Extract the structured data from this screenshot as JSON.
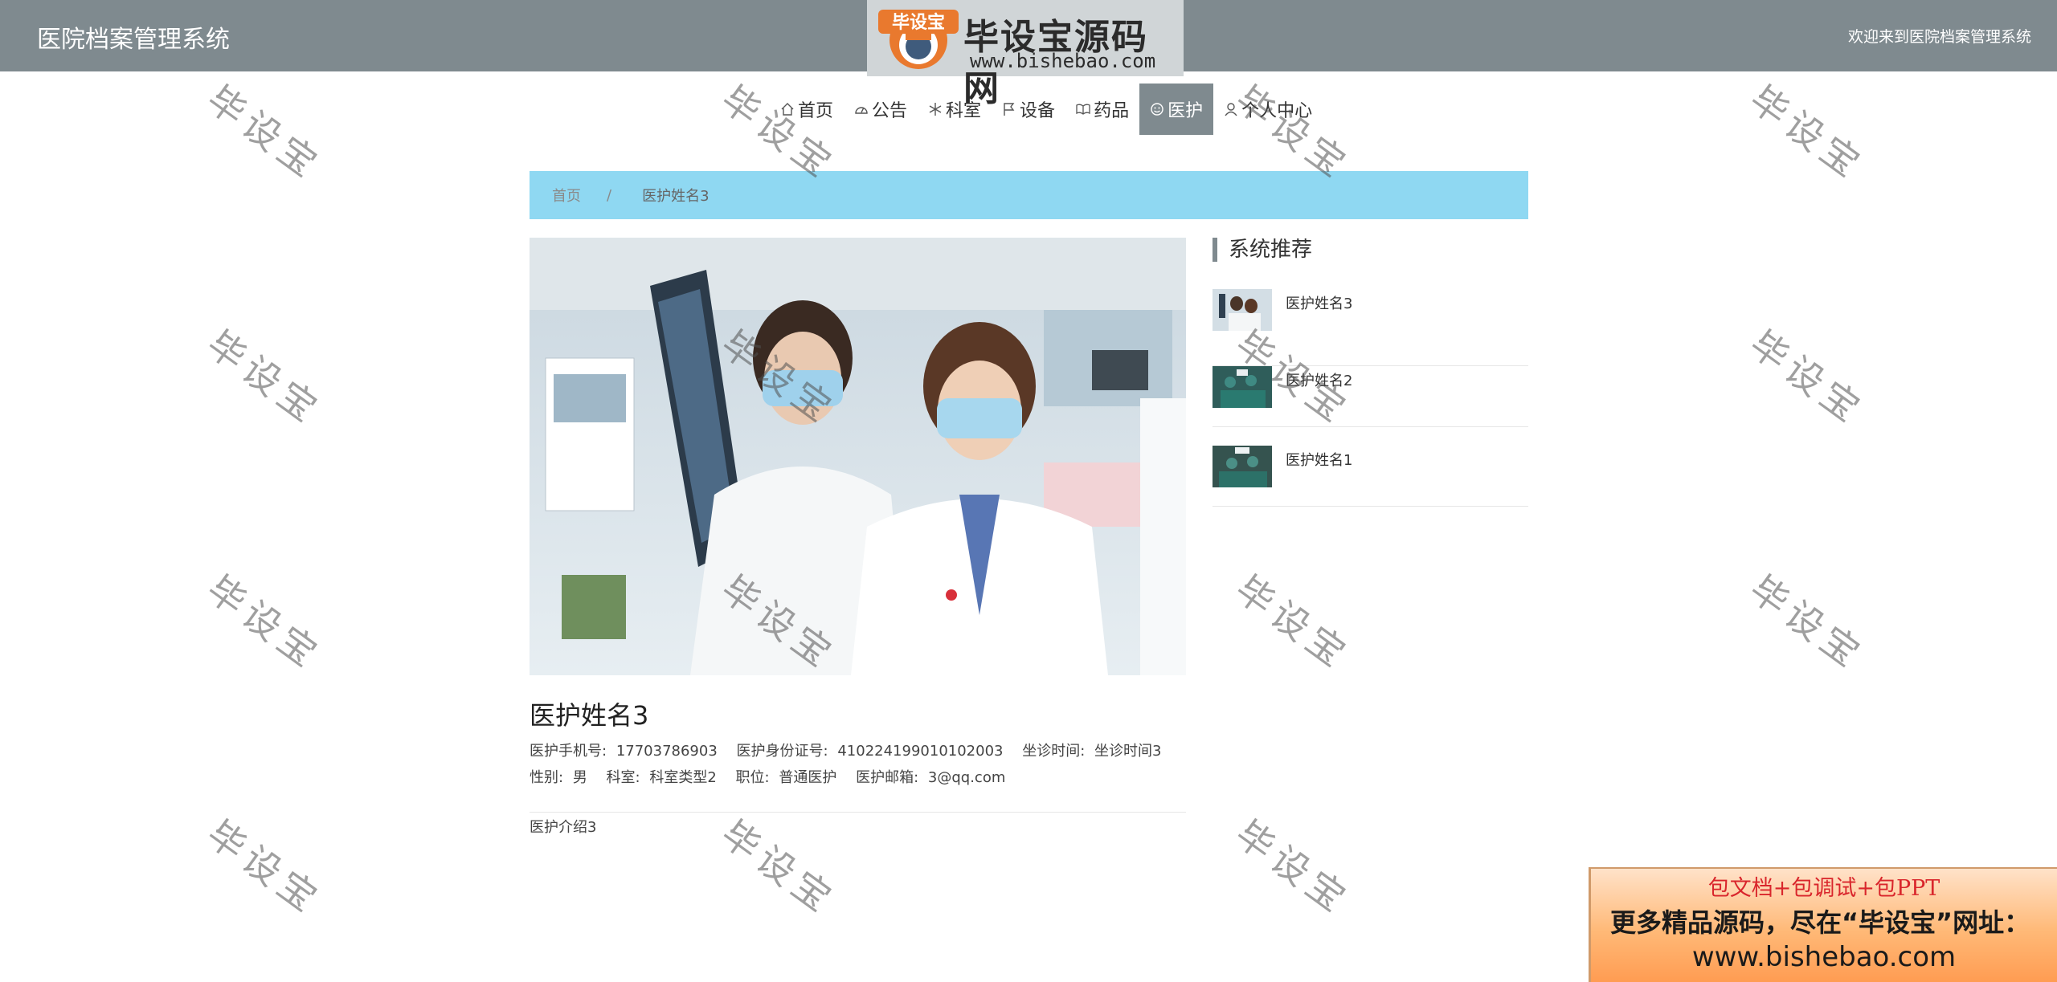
{
  "header": {
    "title": "医院档案管理系统",
    "welcome": "欢迎来到医院档案管理系统"
  },
  "logo": {
    "badge": "毕设宝",
    "name": "毕设宝源码网",
    "url": "www.bishebao.com"
  },
  "nav": {
    "items": [
      {
        "label": "首页",
        "icon": "home-icon"
      },
      {
        "label": "公告",
        "icon": "gauge-icon"
      },
      {
        "label": "科室",
        "icon": "snowflake-icon"
      },
      {
        "label": "设备",
        "icon": "flag-icon"
      },
      {
        "label": "药品",
        "icon": "book-icon"
      },
      {
        "label": "医护",
        "icon": "face-icon",
        "active": true
      },
      {
        "label": "个人中心",
        "icon": "user-icon"
      }
    ]
  },
  "breadcrumb": {
    "home": "首页",
    "separator": "/",
    "current": "医护姓名3"
  },
  "detail": {
    "name": "医护姓名3",
    "phone_label": "医护手机号:",
    "phone": "17703786903",
    "id_label": "医护身份证号:",
    "id": "410224199010102003",
    "time_label": "坐诊时间:",
    "time": "坐诊时间3",
    "gender_label": "性别:",
    "gender": "男",
    "dept_label": "科室:",
    "dept": "科室类型2",
    "position_label": "职位:",
    "position": "普通医护",
    "email_label": "医护邮箱:",
    "email": "3@qq.com",
    "intro": "医护介绍3"
  },
  "sidebar": {
    "title": "系统推荐",
    "items": [
      {
        "name": "医护姓名3"
      },
      {
        "name": "医护姓名2"
      },
      {
        "name": "医护姓名1"
      }
    ]
  },
  "watermark": {
    "text": "毕设宝"
  },
  "promo": {
    "top": "包文档+包调试+包PPT",
    "middle": "更多精品源码，尽在“毕设宝”网址：",
    "url": "www.bishebao.com"
  },
  "colors": {
    "header_bg": "#7f8a8f",
    "breadcrumb_bg": "#8fd8f2",
    "active_nav": "#7f8a8f"
  }
}
